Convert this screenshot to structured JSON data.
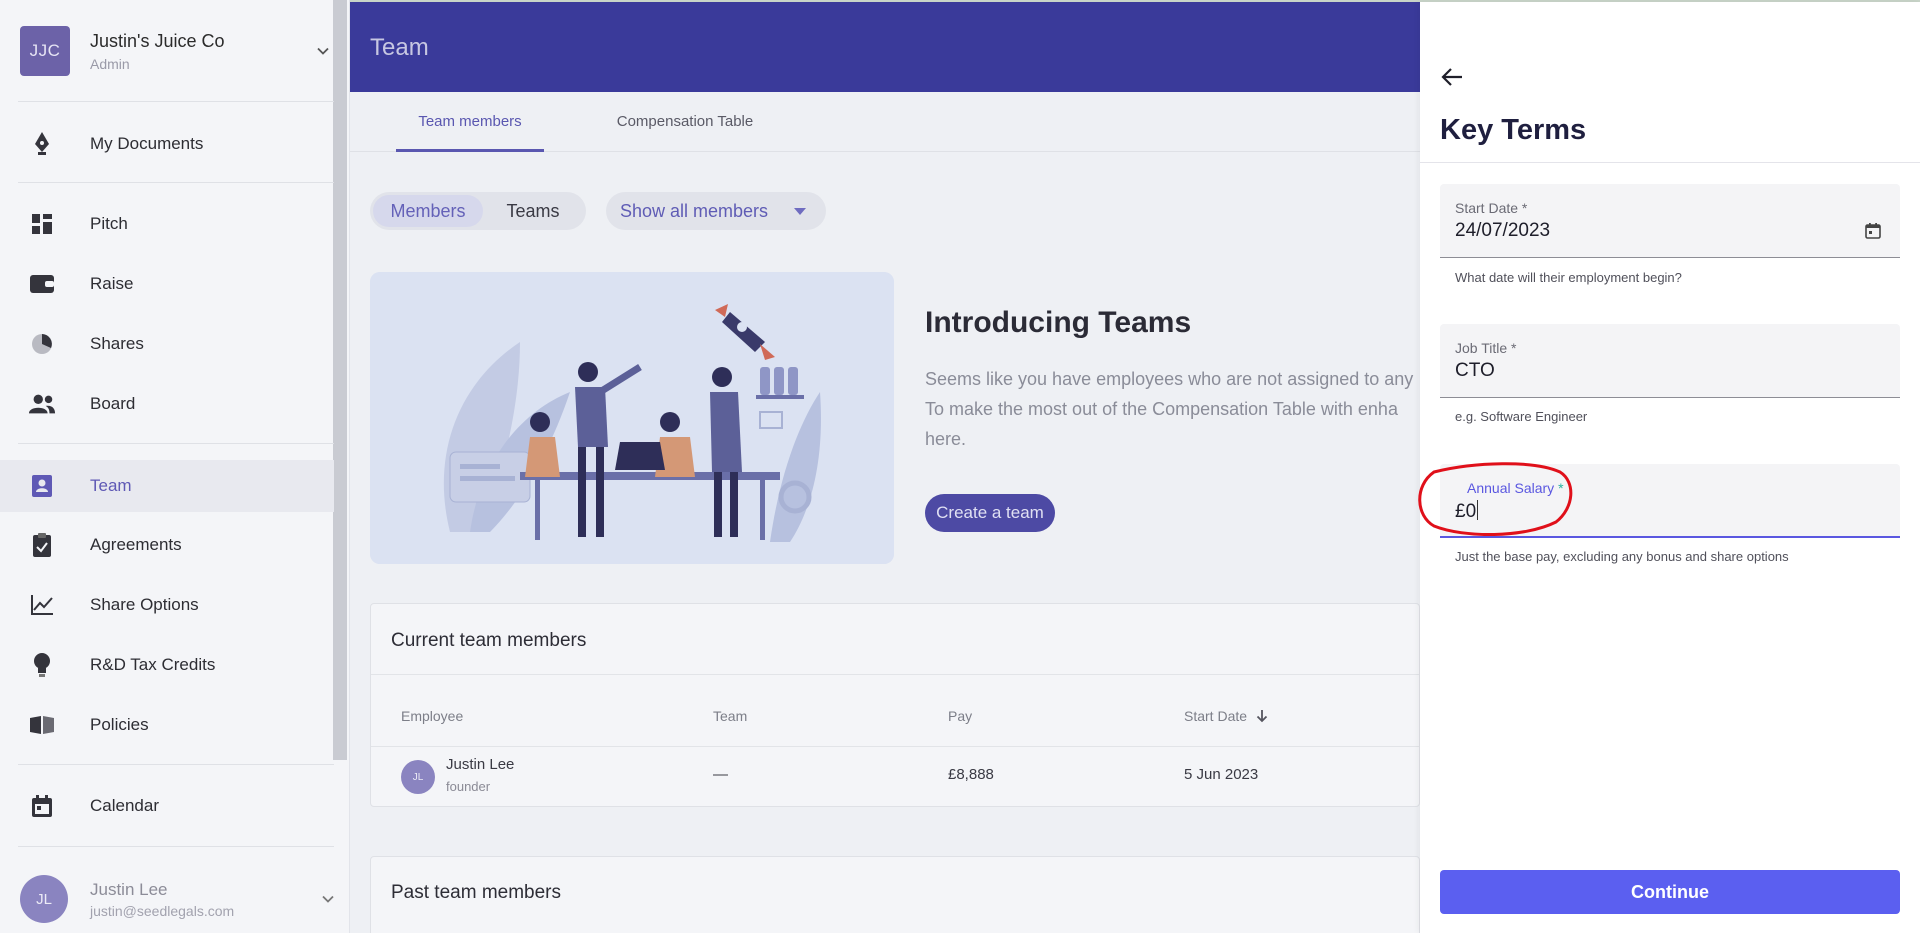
{
  "org": {
    "initials": "JJC",
    "name": "Justin's Juice Co",
    "role": "Admin"
  },
  "sidebar": {
    "items": [
      {
        "label": "My Documents",
        "icon": "pen-nib-icon"
      },
      {
        "label": "Pitch",
        "icon": "pitch-blocks-icon"
      },
      {
        "label": "Raise",
        "icon": "wallet-icon"
      },
      {
        "label": "Shares",
        "icon": "pie-chart-icon"
      },
      {
        "label": "Board",
        "icon": "people-icon"
      },
      {
        "label": "Team",
        "icon": "badge-icon",
        "active": true
      },
      {
        "label": "Agreements",
        "icon": "clipboard-check-icon"
      },
      {
        "label": "Share Options",
        "icon": "line-chart-icon"
      },
      {
        "label": "R&D Tax Credits",
        "icon": "lightbulb-icon"
      },
      {
        "label": "Policies",
        "icon": "book-icon"
      },
      {
        "label": "Calendar",
        "icon": "calendar-icon"
      }
    ]
  },
  "user": {
    "initials": "JL",
    "name": "Justin Lee",
    "email": "justin@seedlegals.com"
  },
  "header": {
    "title": "Team"
  },
  "tabs": [
    {
      "label": "Team members",
      "active": true
    },
    {
      "label": "Compensation Table",
      "active": false
    }
  ],
  "toggle": {
    "members": "Members",
    "teams": "Teams"
  },
  "filter": {
    "label": "Show all members"
  },
  "promo": {
    "title": "Introducing Teams",
    "line1": "Seems like you have employees who are not assigned to any",
    "line2": "To make the most out of the Compensation Table with enha",
    "line3": "here.",
    "button": "Create a team"
  },
  "current": {
    "title": "Current team members",
    "columns": {
      "employee": "Employee",
      "team": "Team",
      "pay": "Pay",
      "start": "Start Date"
    },
    "rows": [
      {
        "initials": "JL",
        "name": "Justin Lee",
        "role": "founder",
        "team": "—",
        "pay": "£8,888",
        "start": "5 Jun 2023"
      }
    ]
  },
  "past": {
    "title": "Past team members"
  },
  "panel": {
    "title": "Key Terms",
    "start_date": {
      "label": "Start Date",
      "required": "*",
      "value": "24/07/2023",
      "helper": "What date will their employment begin?"
    },
    "job_title": {
      "label": "Job Title",
      "required": "*",
      "value": "CTO",
      "helper": "e.g. Software Engineer"
    },
    "salary": {
      "label": "Annual Salary",
      "required": "*",
      "value": "£0",
      "helper": "Just the base pay, excluding any bonus and share options"
    },
    "continue": "Continue"
  },
  "colors": {
    "brand": "#3a3a9a",
    "accent": "#5b5ff0",
    "highlight": "#e0101a",
    "required_focus": "#2ab1a0"
  }
}
